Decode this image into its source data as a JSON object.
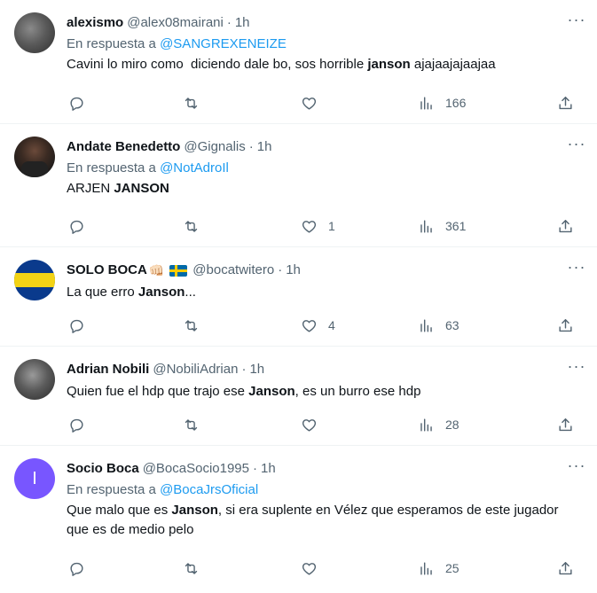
{
  "tweets": [
    {
      "name": "alexismo",
      "handle": "@alex08mairani",
      "time": "1h",
      "reply_prefix": "En respuesta a",
      "reply_to": "@SANGREXENEIZE",
      "text_before": "Cavini lo miro como  diciendo dale bo, sos horrible ",
      "text_bold": "janson",
      "text_after": " ajajaajajaajaa",
      "likes": "",
      "views": "166",
      "avatar": "photo"
    },
    {
      "name": "Andate Benedetto",
      "handle": "@Gignalis",
      "time": "1h",
      "reply_prefix": "En respuesta a",
      "reply_to": "@NotAdroIl",
      "text_before": "ARJEN ",
      "text_bold": "JANSON",
      "text_after": "",
      "likes": "1",
      "views": "361",
      "avatar": "photo"
    },
    {
      "name": "SOLO BOCA",
      "handle": "@bocatwitero",
      "time": "1h",
      "text_before": "La que erro ",
      "text_bold": "Janson",
      "text_after": "...",
      "likes": "4",
      "views": "63",
      "avatar": "boca-logo"
    },
    {
      "name": "Adrian Nobili",
      "handle": "@NobiliAdrian",
      "time": "1h",
      "text_before": "Quien fue el hdp que trajo ese ",
      "text_bold": "Janson",
      "text_after": ", es un burro ese hdp",
      "likes": "",
      "views": "28",
      "avatar": "photo"
    },
    {
      "name": "Socio Boca",
      "handle": "@BocaSocio1995",
      "time": "1h",
      "reply_prefix": "En respuesta a",
      "reply_to": "@BocaJrsOficial",
      "text_before": "Que malo que es ",
      "text_bold": "Janson",
      "text_after": ", si era suplente en Vélez que esperamos de este jugador que es de medio pelo",
      "likes": "",
      "views": "25",
      "avatar_letter": "I"
    }
  ],
  "icons": {
    "more": "more-horizontal-icon",
    "reply": "reply-bubble-icon",
    "retweet": "retweet-icon",
    "like": "heart-icon",
    "views": "bar-chart-icon",
    "share": "share-upload-icon"
  },
  "colors": {
    "link": "#1d9bf0",
    "secondary_text": "#536471",
    "primary_text": "#0f1419",
    "divider": "#eff3f4",
    "letter_avatar": "#7856ff"
  }
}
